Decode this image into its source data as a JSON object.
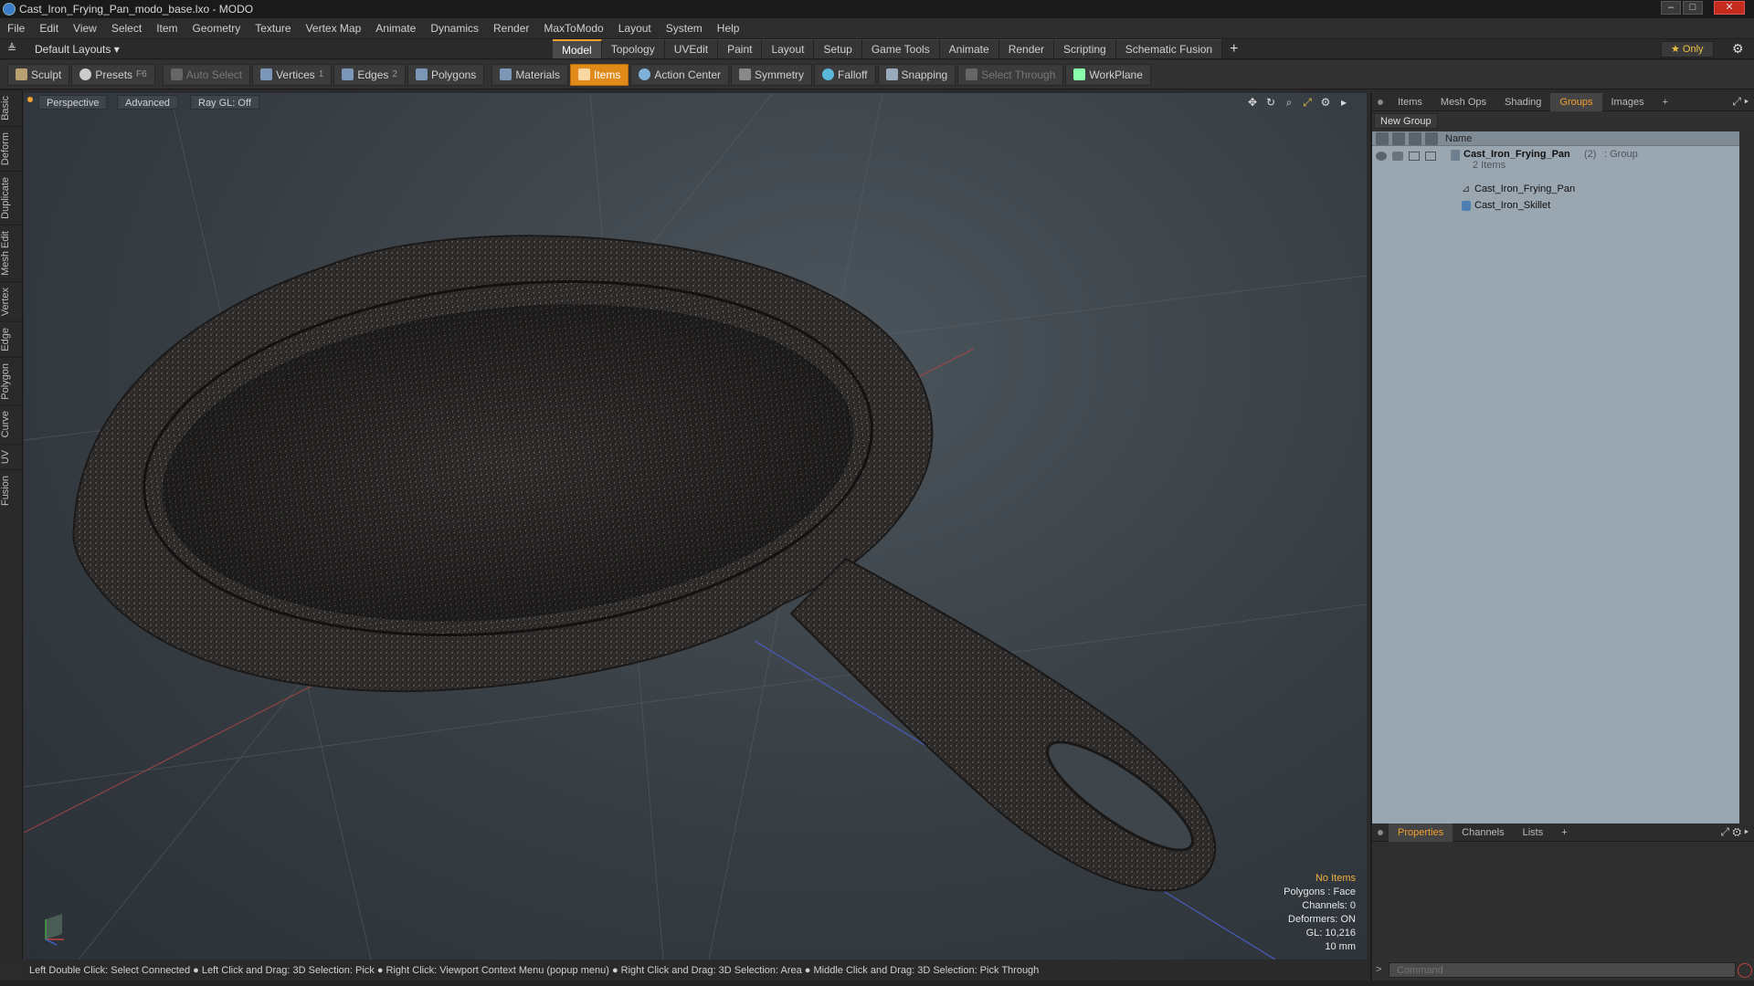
{
  "window": {
    "title": "Cast_Iron_Frying_Pan_modo_base.lxo - MODO"
  },
  "menu": [
    "File",
    "Edit",
    "View",
    "Select",
    "Item",
    "Geometry",
    "Texture",
    "Vertex Map",
    "Animate",
    "Dynamics",
    "Render",
    "MaxToModo",
    "Layout",
    "System",
    "Help"
  ],
  "layout": {
    "preset": "Default Layouts ▾",
    "tabs": [
      "Model",
      "Topology",
      "UVEdit",
      "Paint",
      "Layout",
      "Setup",
      "Game Tools",
      "Animate",
      "Render",
      "Scripting",
      "Schematic Fusion"
    ],
    "active_tab": "Model",
    "only_label": "★ Only"
  },
  "toolbar": {
    "sculpt": "Sculpt",
    "presets": "Presets",
    "presets_key": "F6",
    "auto_select": "Auto Select",
    "vertices": "Vertices",
    "vertices_count": "1",
    "edges": "Edges",
    "edges_count": "2",
    "polygons": "Polygons",
    "materials": "Materials",
    "items": "Items",
    "action_center": "Action Center",
    "symmetry": "Symmetry",
    "falloff": "Falloff",
    "snapping": "Snapping",
    "select_through": "Select Through",
    "workplane": "WorkPlane"
  },
  "left_tabs": [
    "Basic",
    "Deform",
    "Duplicate",
    "Mesh Edit",
    "Vertex",
    "Edge",
    "Polygon",
    "Curve",
    "UV",
    "Fusion"
  ],
  "viewport": {
    "view": "Perspective",
    "shading": "Advanced",
    "raygl": "Ray GL: Off",
    "stats": {
      "selection": "No Items",
      "polygons": "Polygons : Face",
      "channels": "Channels: 0",
      "deformers": "Deformers: ON",
      "gl": "GL: 10,216",
      "scale": "10 mm"
    }
  },
  "status": "Left Double Click: Select Connected ● Left Click and Drag: 3D Selection: Pick ● Right Click: Viewport Context Menu (popup menu) ● Right Click and Drag: 3D Selection: Area ● Middle Click and Drag: 3D Selection: Pick Through",
  "panel": {
    "tabs": [
      "Items",
      "Mesh Ops",
      "Shading",
      "Groups",
      "Images"
    ],
    "active_tab": "Groups",
    "new_group": "New Group",
    "column_name": "Name",
    "group": {
      "name": "Cast_Iron_Frying_Pan",
      "count": "(2)",
      "type": ": Group",
      "sub": "2 Items"
    },
    "children": [
      "Cast_Iron_Frying_Pan",
      "Cast_Iron_Skillet"
    ],
    "lower_tabs": [
      "Properties",
      "Channels",
      "Lists"
    ],
    "lower_active": "Properties",
    "command_placeholder": "Command"
  },
  "colors": {
    "accent": "#f0a030",
    "active_tool": "#e08a1a"
  }
}
